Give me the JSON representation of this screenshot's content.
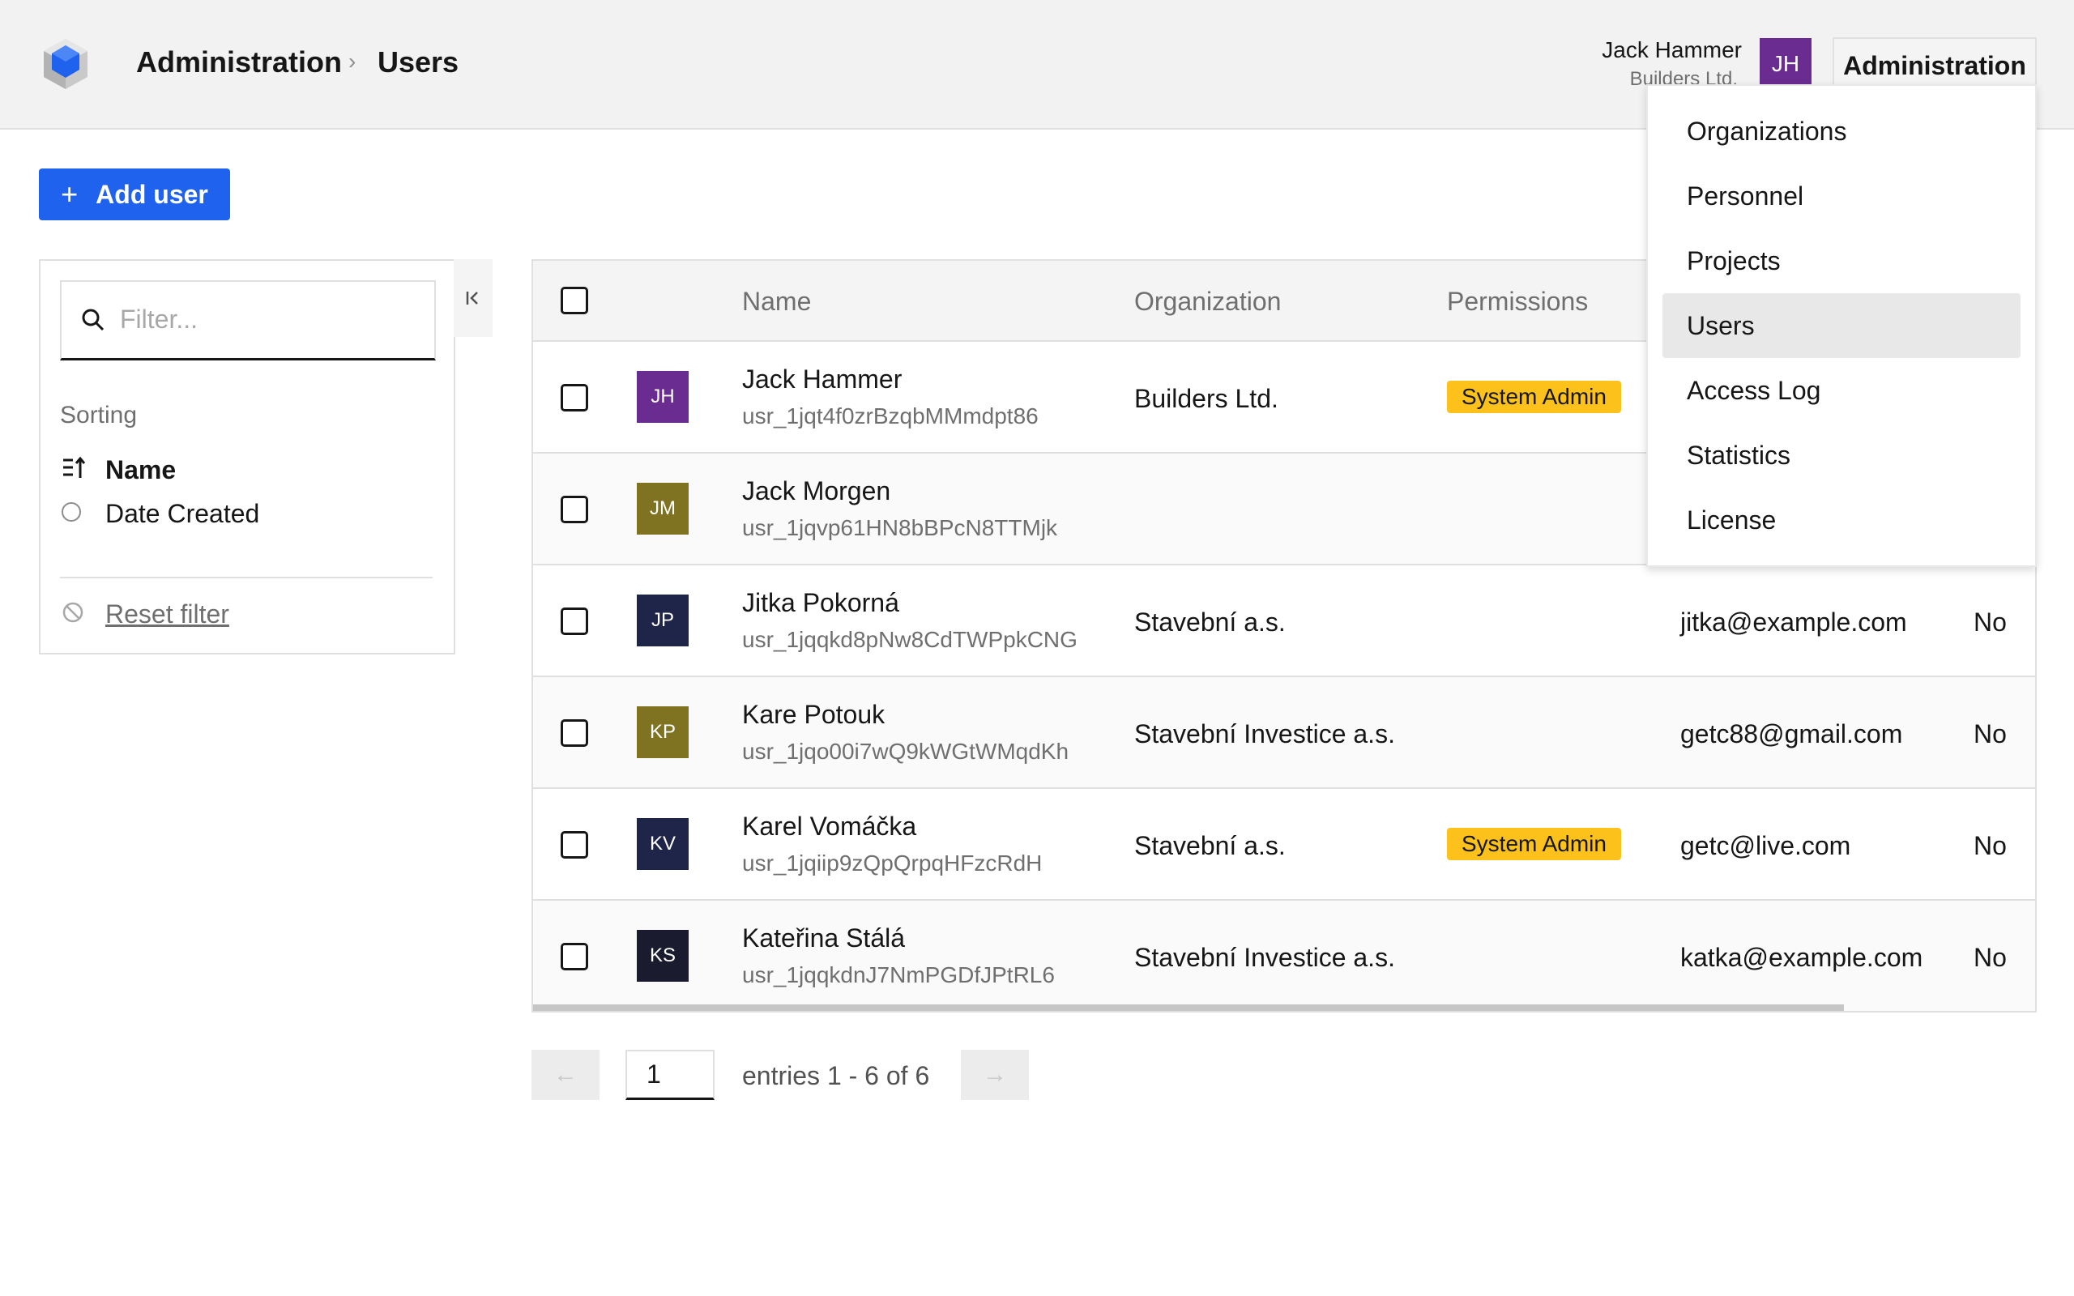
{
  "header": {
    "breadcrumb": [
      "Administration",
      "Users"
    ],
    "user_name": "Jack Hammer",
    "user_org": "Builders Ltd.",
    "user_initials": "JH",
    "admin_button": "Administration"
  },
  "toolbar": {
    "add_user_label": "Add user"
  },
  "sidebar": {
    "filter_placeholder": "Filter...",
    "sorting_label": "Sorting",
    "sort_options": [
      "Name",
      "Date Created"
    ],
    "reset_label": "Reset filter"
  },
  "table": {
    "columns": [
      "Name",
      "Organization",
      "Permissions"
    ],
    "rows": [
      {
        "initials": "JH",
        "avatar_color": "#6a2c91",
        "name": "Jack Hammer",
        "id": "usr_1jqt4f0zrBzqbMMmdpt86",
        "org": "Builders Ltd.",
        "perm": "System Admin",
        "email": "",
        "flag": ""
      },
      {
        "initials": "JM",
        "avatar_color": "#7f7322",
        "name": "Jack Morgen",
        "id": "usr_1jqvp61HN8bBPcN8TTMjk",
        "org": "",
        "perm": "",
        "email": "",
        "flag": ""
      },
      {
        "initials": "JP",
        "avatar_color": "#1f2449",
        "name": "Jitka Pokorná",
        "id": "usr_1jqqkd8pNw8CdTWPpkCNG",
        "org": "Stavební a.s.",
        "perm": "",
        "email": "jitka@example.com",
        "flag": "No"
      },
      {
        "initials": "KP",
        "avatar_color": "#7f7322",
        "name": "Kare Potouk",
        "id": "usr_1jqo00i7wQ9kWGtWMqdKh",
        "org": "Stavební Investice a.s.",
        "perm": "",
        "email": "getc88@gmail.com",
        "flag": "No"
      },
      {
        "initials": "KV",
        "avatar_color": "#1f2449",
        "name": "Karel Vomáčka",
        "id": "usr_1jqiip9zQpQrpqHFzcRdH",
        "org": "Stavební a.s.",
        "perm": "System Admin",
        "email": "getc@live.com",
        "flag": "No"
      },
      {
        "initials": "KS",
        "avatar_color": "#1b1b2f",
        "name": "Kateřina Stálá",
        "id": "usr_1jqqkdnJ7NmPGDfJPtRL6",
        "org": "Stavební Investice a.s.",
        "perm": "",
        "email": "katka@example.com",
        "flag": "No"
      }
    ]
  },
  "pagination": {
    "page": "1",
    "info": "entries 1 - 6 of 6"
  },
  "menu": {
    "items": [
      "Organizations",
      "Personnel",
      "Projects",
      "Users",
      "Access Log",
      "Statistics",
      "License"
    ],
    "active": "Users"
  }
}
